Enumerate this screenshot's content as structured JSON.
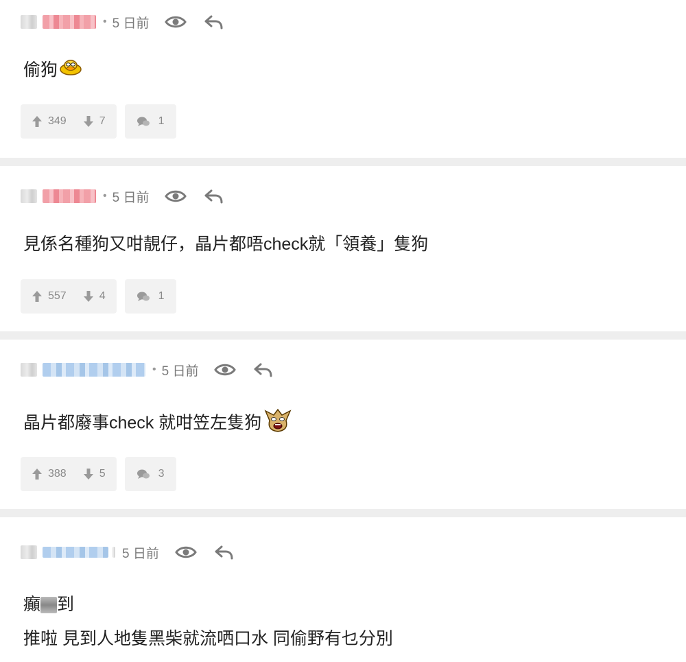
{
  "comments": [
    {
      "time": "5 日前",
      "lines": [
        "偷狗"
      ],
      "emoji": "duck-emoji",
      "upvotes": "349",
      "downvotes": "7",
      "replies": "1"
    },
    {
      "time": "5 日前",
      "lines": [
        "見係名種狗又咁靚仔，晶片都唔check就「領養」隻狗"
      ],
      "upvotes": "557",
      "downvotes": "4",
      "replies": "1"
    },
    {
      "time": "5 日前",
      "lines": [
        "晶片都廢事check 就咁笠左隻狗"
      ],
      "emoji": "angry-emoji",
      "upvotes": "388",
      "downvotes": "5",
      "replies": "3"
    },
    {
      "time": "5 日前",
      "lines": [
        "癲",
        "到",
        "推啦 見到人地隻黑柴就流哂口水 同偷野有乜分別"
      ]
    }
  ],
  "colors": {
    "meta_text": "#7a7a7a",
    "action_bg": "#f2f2f2",
    "divider": "#eeeeee"
  },
  "icons": {
    "view": "eye-icon",
    "reply": "reply-arrow-icon",
    "upvote": "arrow-up-icon",
    "downvote": "arrow-down-icon",
    "comment_count": "chat-bubble-icon"
  }
}
